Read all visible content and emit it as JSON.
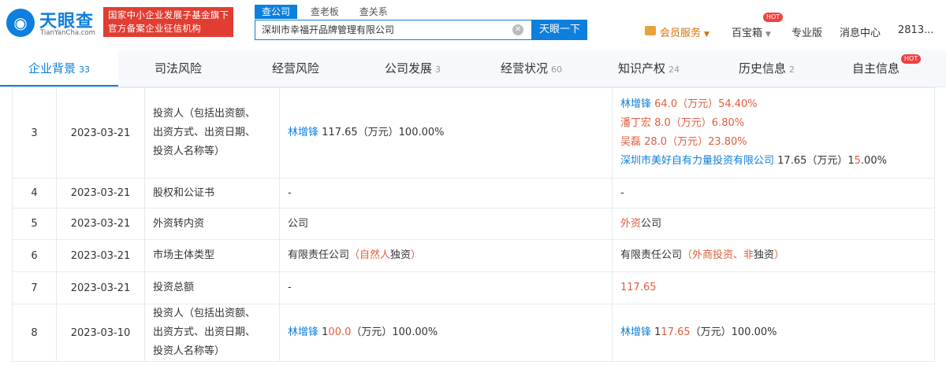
{
  "logo": {
    "name_cn": "天眼查",
    "name_en": "TianYanCha.com"
  },
  "promo": {
    "line1": "国家中小企业发展子基金旗下",
    "line2": "官方备案企业征信机构"
  },
  "search": {
    "tabs": [
      "查公司",
      "查老板",
      "查关系"
    ],
    "value": "深圳市幸福开品牌管理有限公司",
    "button": "天眼一下"
  },
  "nav": {
    "vip": "会员服务",
    "baibaoxiang": "百宝箱",
    "hot": "HOT",
    "pro": "专业版",
    "messages": "消息中心",
    "user": "2813..."
  },
  "tabs": [
    {
      "label": "企业背景",
      "count": "33"
    },
    {
      "label": "司法风险",
      "count": ""
    },
    {
      "label": "经营风险",
      "count": ""
    },
    {
      "label": "公司发展",
      "count": "3"
    },
    {
      "label": "经营状况",
      "count": "60"
    },
    {
      "label": "知识产权",
      "count": "24"
    },
    {
      "label": "历史信息",
      "count": "2"
    },
    {
      "label": "自主信息",
      "count": "",
      "badge": "HOT"
    }
  ],
  "rows": [
    {
      "idx": "3",
      "date": "2023-03-21",
      "item": [
        "投资人（包括出资额、",
        "出资方式、出资日期、",
        "投资人名称等）"
      ],
      "before": [
        [
          {
            "t": "林增锋",
            "c": "blue"
          },
          {
            "t": " 1",
            "c": ""
          },
          {
            "t": "17.65（万元）1",
            "c": ""
          },
          {
            "t": "00.00%",
            "c": ""
          }
        ]
      ],
      "after": [
        [
          {
            "t": "林增锋",
            "c": "blue"
          },
          {
            "t": " 64.0（万元）54.40%",
            "c": "red"
          }
        ],
        [
          {
            "t": "潘丁宏 8.0（万元）6.80%",
            "c": "red"
          }
        ],
        [
          {
            "t": "吴磊 28.0（万元）23.80%",
            "c": "red"
          }
        ],
        [
          {
            "t": "深圳市美好自有力量投资有限公司",
            "c": "blue"
          },
          {
            "t": " 17.65（万元）1",
            "c": ""
          },
          {
            "t": "5",
            "c": "red"
          },
          {
            "t": ".00%",
            "c": ""
          }
        ]
      ]
    },
    {
      "idx": "4",
      "date": "2023-03-21",
      "item": [
        "股权和公证书"
      ],
      "before": [
        [
          {
            "t": "-",
            "c": ""
          }
        ]
      ],
      "after": [
        [
          {
            "t": "-",
            "c": ""
          }
        ]
      ]
    },
    {
      "idx": "5",
      "date": "2023-03-21",
      "item": [
        "外资转内资"
      ],
      "before": [
        [
          {
            "t": "公司",
            "c": ""
          }
        ]
      ],
      "after": [
        [
          {
            "t": "外资",
            "c": "red"
          },
          {
            "t": "公司",
            "c": ""
          }
        ]
      ]
    },
    {
      "idx": "6",
      "date": "2023-03-21",
      "item": [
        "市场主体类型"
      ],
      "before": [
        [
          {
            "t": "有限责任公司",
            "c": ""
          },
          {
            "t": "（自然人",
            "c": "red"
          },
          {
            "t": "独资",
            "c": ""
          },
          {
            "t": "）",
            "c": "red"
          }
        ]
      ],
      "after": [
        [
          {
            "t": "有限责任公司",
            "c": ""
          },
          {
            "t": "（外商投资、非",
            "c": "red"
          },
          {
            "t": "独资",
            "c": ""
          },
          {
            "t": "）",
            "c": "red"
          }
        ]
      ]
    },
    {
      "idx": "7",
      "date": "2023-03-21",
      "item": [
        "投资总额"
      ],
      "before": [
        [
          {
            "t": "-",
            "c": ""
          }
        ]
      ],
      "after": [
        [
          {
            "t": "117.65",
            "c": "red"
          }
        ]
      ]
    },
    {
      "idx": "8",
      "date": "2023-03-10",
      "item": [
        "投资人（包括出资额、",
        "出资方式、出资日期、",
        "投资人名称等）"
      ],
      "before": [
        [
          {
            "t": "林增锋",
            "c": "blue"
          },
          {
            "t": " 1",
            "c": ""
          },
          {
            "t": "00.0",
            "c": "red"
          },
          {
            "t": "（万元）100.00%",
            "c": ""
          }
        ]
      ],
      "after": [
        [
          {
            "t": "林增锋",
            "c": "blue"
          },
          {
            "t": " 1",
            "c": ""
          },
          {
            "t": "17.65",
            "c": "red"
          },
          {
            "t": "（万元）100.00%",
            "c": ""
          }
        ]
      ]
    }
  ],
  "colors": {
    "brand": "#0e7fdd",
    "changed": "#e05e3f",
    "promo": "#e23d32"
  }
}
